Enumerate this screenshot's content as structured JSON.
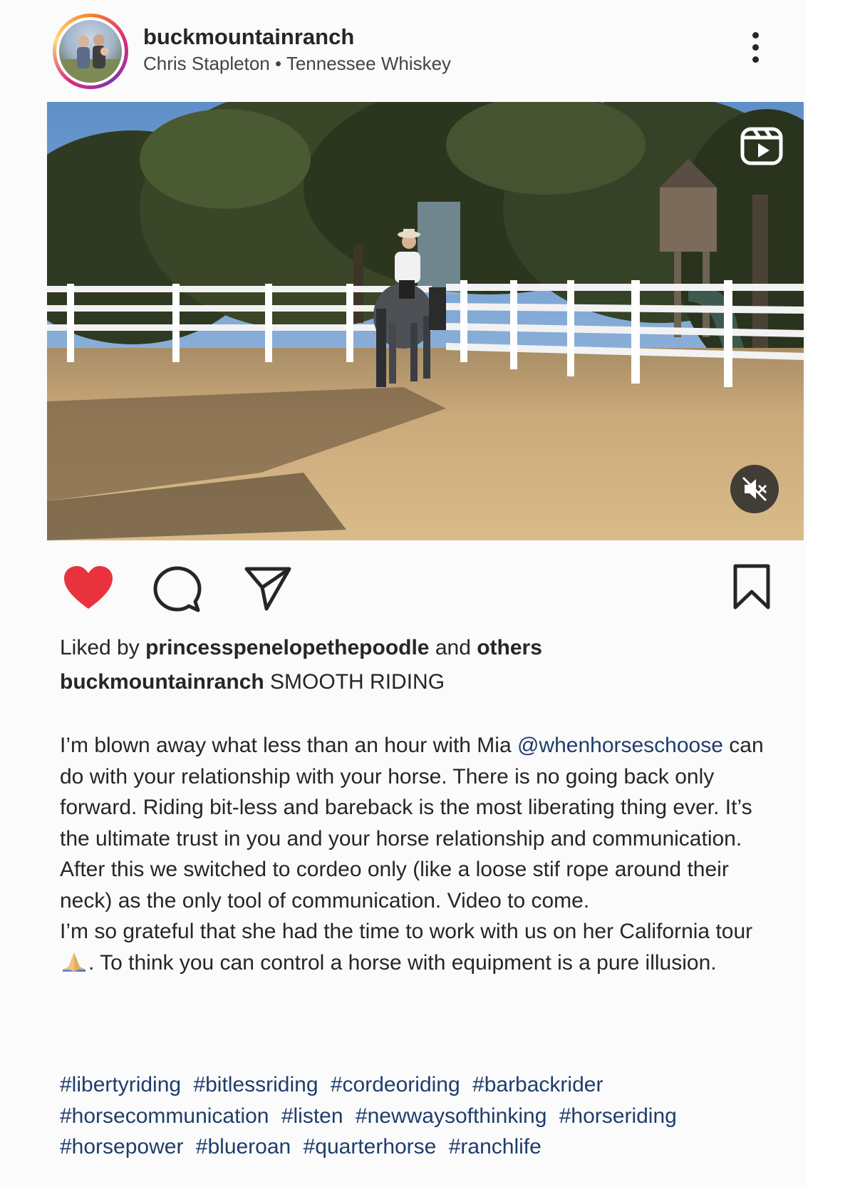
{
  "header": {
    "username": "buckmountainranch",
    "audio": "Chris Stapleton • Tennessee Whiskey"
  },
  "post": {
    "liked_prefix": "Liked by ",
    "liked_user": "princesspenelopethepoodle",
    "liked_mid": " and ",
    "liked_others": "others",
    "caption_user": "buckmountainranch",
    "caption_title": " SMOOTH RIDING",
    "caption_p1_a": "I’m blown away what less than an hour with Mia ",
    "caption_mention": "@whenhorseschoose",
    "caption_p1_b": " can do with your relationship with your horse. There is no going back only forward. Riding bit-less and bareback is the most liberating thing ever. It’s the ultimate trust in you and your horse relationship and communication. After this we switched to cordeo only (like a loose stif rope around their neck) as the only tool of communication. Video to come.",
    "caption_p2_a": "I’m so grateful that she had the time to work with us on her California tour ",
    "caption_p2_b": ". To think you can control a horse with equipment is a pure illusion.",
    "emoji": "folded-hands",
    "hashtags": [
      "#libertyriding",
      "#bitlessriding",
      "#cordeoriding",
      "#barbackrider",
      "#horsecommunication",
      "#listen",
      "#newwaysofthinking",
      "#horseriding",
      "#horsepower",
      "#blueroan",
      "#quarterhorse",
      "#ranchlife"
    ]
  },
  "icons": {
    "like": "heart-icon",
    "comment": "comment-icon",
    "share": "share-icon",
    "save": "bookmark-icon",
    "reel": "reel-icon",
    "mute": "muted-speaker-icon",
    "more": "more-options-icon"
  },
  "colors": {
    "like_red": "#e8333e",
    "link_blue": "#1f3d6b",
    "text": "#262626"
  }
}
